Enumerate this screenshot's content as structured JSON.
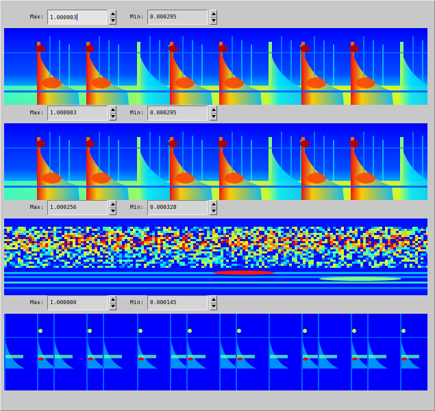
{
  "labels": {
    "max": "Max:",
    "min": "Min:"
  },
  "rows": [
    {
      "max": "1.000003",
      "min": "0.000295"
    },
    {
      "max": "1.000003",
      "min": "0.000295"
    },
    {
      "max": "1.000256",
      "min": "0.000328"
    },
    {
      "max": "1.000000",
      "min": "0.000145"
    }
  ],
  "panels": [
    {
      "kind": "spectrogram-burst"
    },
    {
      "kind": "spectrogram-burst"
    },
    {
      "kind": "spectrogram-noise"
    },
    {
      "kind": "spectrogram-dark"
    }
  ]
}
